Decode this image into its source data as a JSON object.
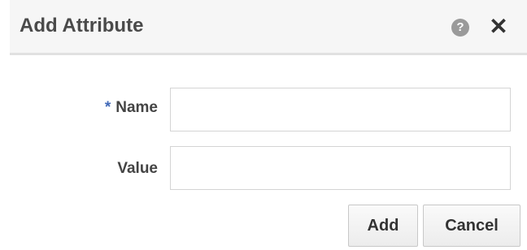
{
  "dialog": {
    "title": "Add Attribute",
    "help_icon": "?",
    "close_icon": "✕"
  },
  "form": {
    "name": {
      "required_mark": "*",
      "label": "Name",
      "value": "",
      "placeholder": ""
    },
    "value": {
      "label": "Value",
      "value": "",
      "placeholder": ""
    }
  },
  "buttons": {
    "add_label": "Add",
    "cancel_label": "Cancel"
  }
}
